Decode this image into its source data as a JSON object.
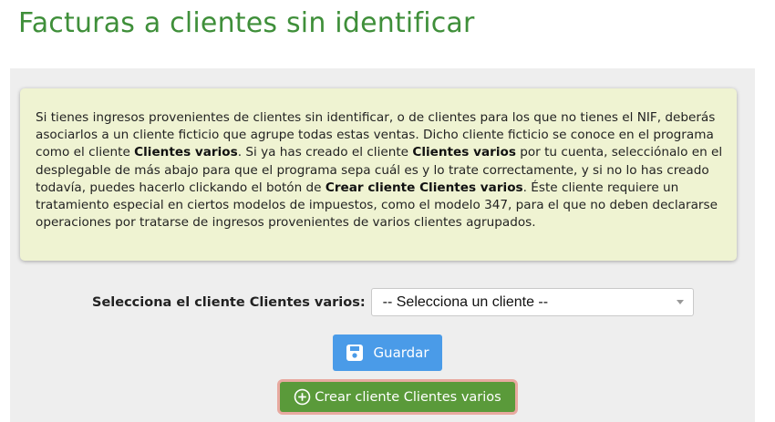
{
  "page_title": "Facturas a clientes sin identificar",
  "info": {
    "t1": "Si tienes ingresos provenientes de clientes sin identificar, o de clientes para los que no tienes el NIF, deberás asociarlos a un cliente ficticio que agrupe todas estas ventas. Dicho cliente ficticio se conoce en el programa como el cliente ",
    "b1": "Clientes varios",
    "t2": ". Si ya has creado el cliente ",
    "b2": "Clientes varios",
    "t3": " por tu cuenta, selecciónalo en el desplegable de más abajo para que el programa sepa cuál es y lo trate correctamente, y si no lo has creado todavía, puedes hacerlo clickando el botón de ",
    "b3": "Crear cliente Clientes varios",
    "t4": ". Éste cliente requiere un tratamiento especial en ciertos modelos de impuestos, como el modelo 347, para el que no deben declararse operaciones por tratarse de ingresos provenientes de varios clientes agrupados."
  },
  "select": {
    "label": "Selecciona el cliente Clientes varios:",
    "value": "-- Selecciona un cliente --"
  },
  "buttons": {
    "save": "Guardar",
    "create": "Crear cliente Clientes varios"
  },
  "colors": {
    "title": "#3f8f3a",
    "info_bg": "#eff3d2",
    "save_bg": "#4a9be8",
    "create_bg": "#5a9a3a"
  },
  "icons": {
    "save": "floppy-disk-icon",
    "create": "plus-circle-icon",
    "select": "chevron-down-icon"
  }
}
